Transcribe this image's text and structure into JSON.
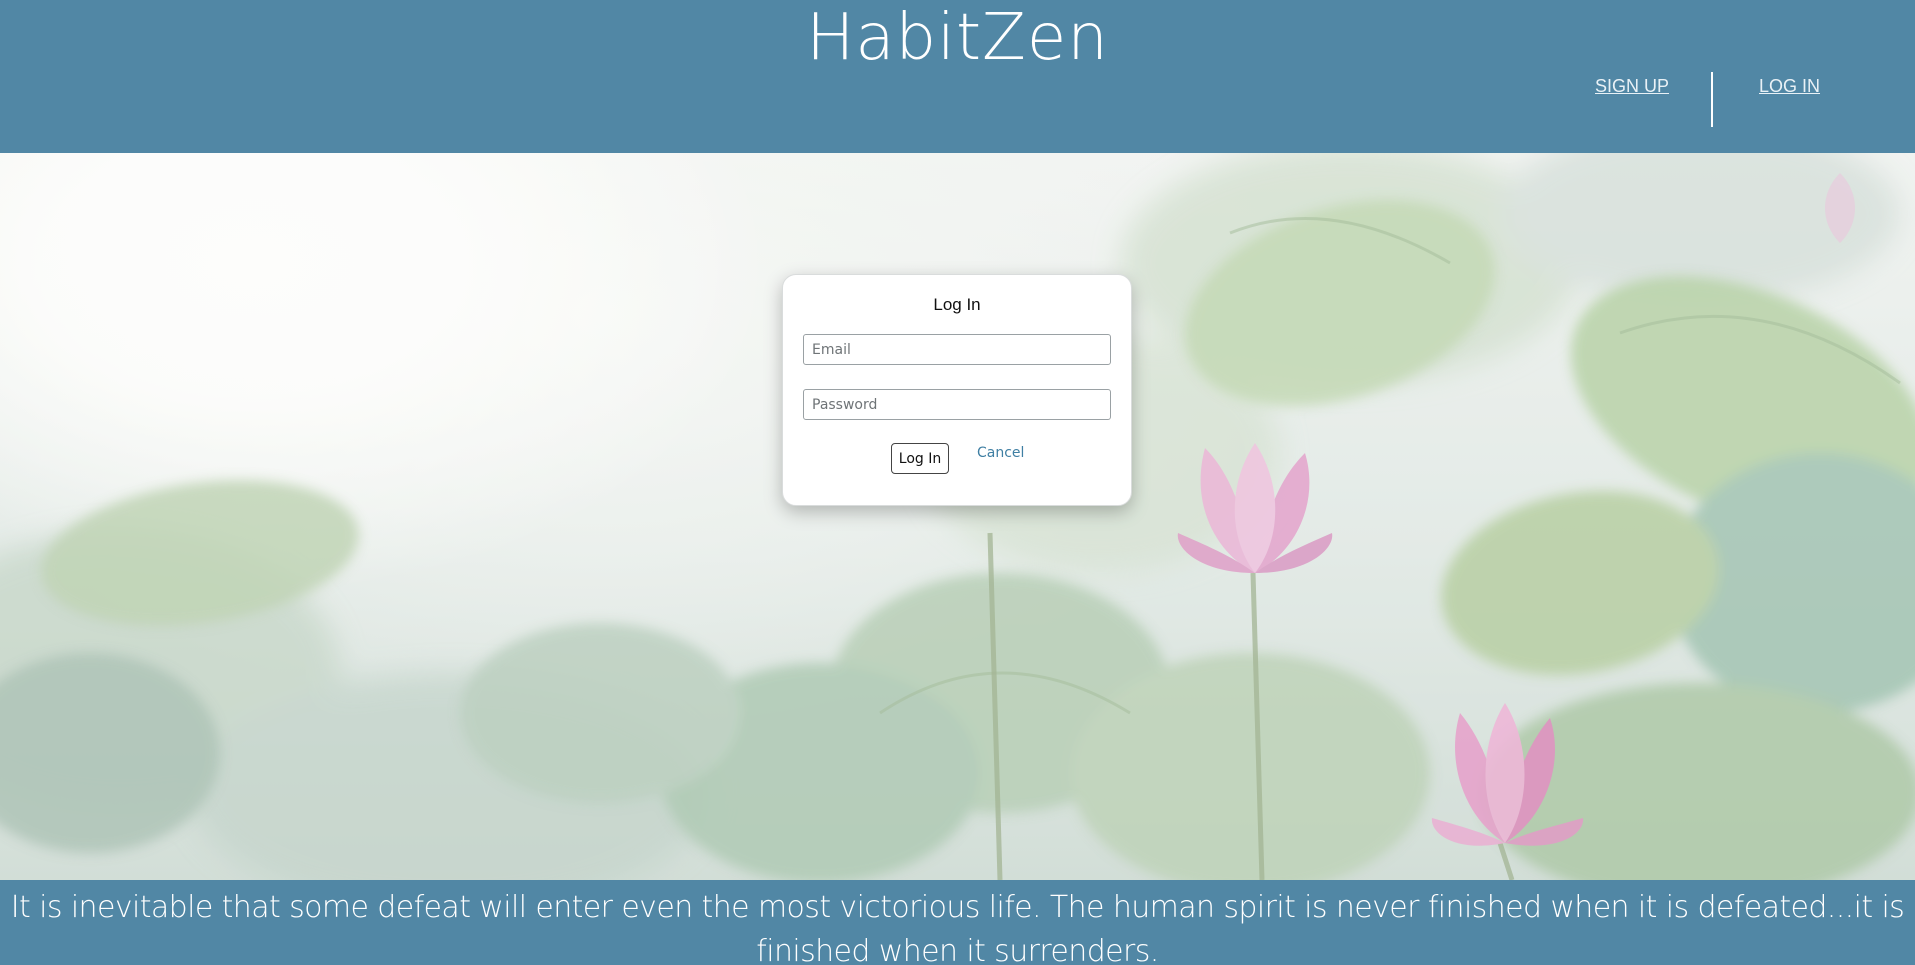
{
  "header": {
    "brand": "HabitZen",
    "nav": {
      "sign_up": "SIGN UP",
      "log_in": "LOG IN"
    }
  },
  "login_form": {
    "title": "Log In",
    "email_placeholder": "Email",
    "password_placeholder": "Password",
    "submit_label": "Log In",
    "cancel_label": "Cancel"
  },
  "quote": {
    "text": "It is inevitable that some defeat will enter even the most victorious life. The human spirit is never finished when it is defeated...it is finished when it surrenders."
  },
  "colors": {
    "header_bg": "#5187a5",
    "footer_bg": "#5187a5",
    "accent_link": "#3f7fa3"
  },
  "background": {
    "scene": "misty-lotus-pond",
    "icon": "lotus-flower-icon"
  }
}
